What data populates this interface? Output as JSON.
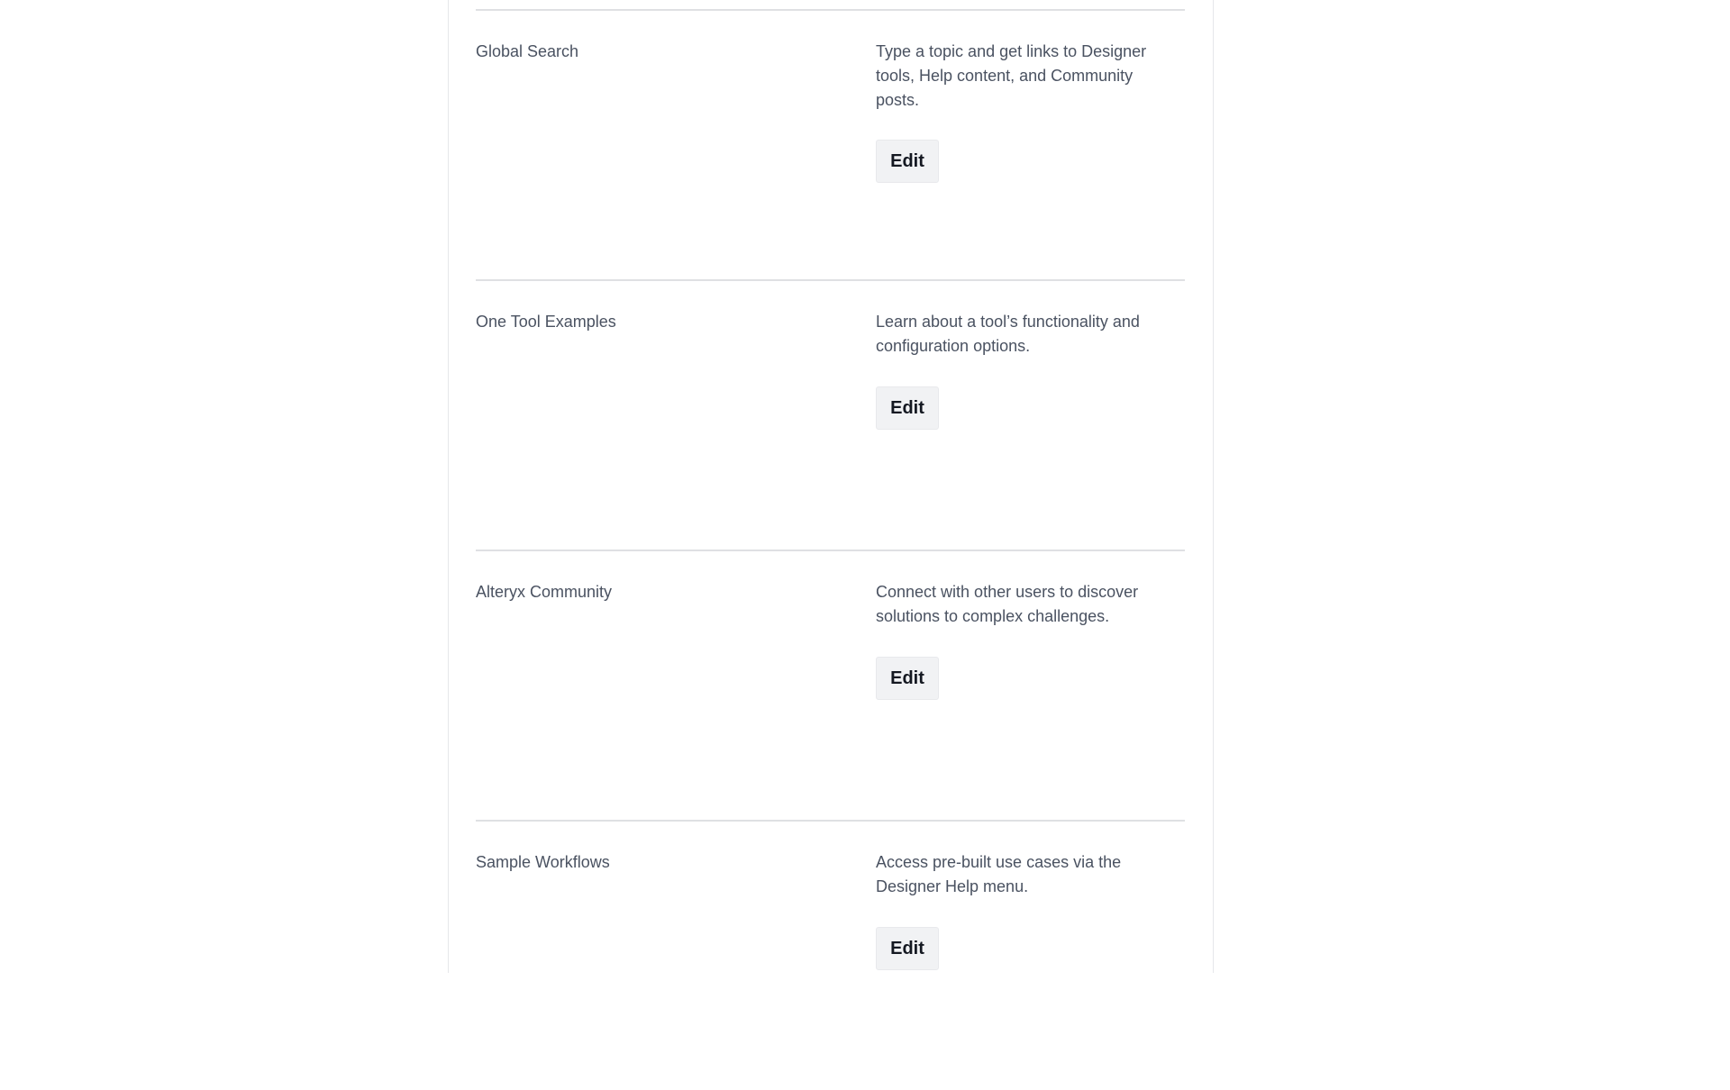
{
  "features": [
    {
      "title": "Global Search",
      "description": "Type a topic and get links to Designer tools, Help content, and Community posts.",
      "edit_label": "Edit"
    },
    {
      "title": "One Tool Examples",
      "description": "Learn about a tool’s functionality and configuration options.",
      "edit_label": "Edit"
    },
    {
      "title": "Alteryx Community",
      "description": "Connect with other users to discover solutions to complex challenges.",
      "edit_label": "Edit"
    },
    {
      "title": "Sample Workflows",
      "description": "Access pre-built use cases via the Designer Help menu.",
      "edit_label": "Edit"
    }
  ]
}
